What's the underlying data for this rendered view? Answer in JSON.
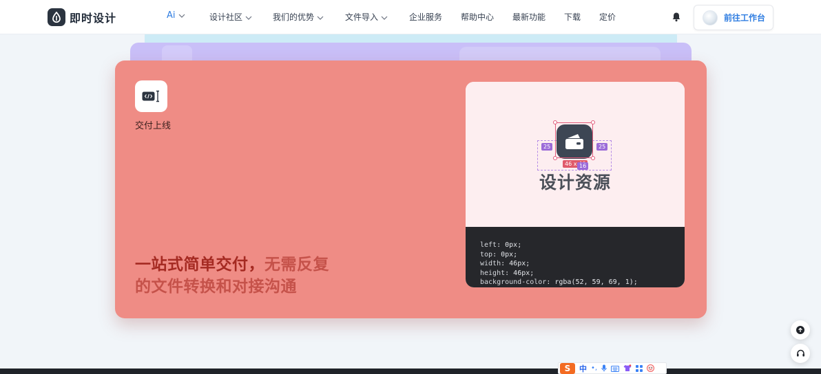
{
  "brand": {
    "name": "即时设计"
  },
  "nav": {
    "ai_label": "Ai",
    "items": [
      {
        "label": "设计社区",
        "has_dropdown": true
      },
      {
        "label": "我们的优势",
        "has_dropdown": true
      },
      {
        "label": "文件导入",
        "has_dropdown": true
      },
      {
        "label": "企业服务",
        "has_dropdown": false
      },
      {
        "label": "帮助中心",
        "has_dropdown": false
      },
      {
        "label": "最新功能",
        "has_dropdown": false
      },
      {
        "label": "下载",
        "has_dropdown": false
      },
      {
        "label": "定价",
        "has_dropdown": false
      }
    ],
    "workbench_label": "前往工作台"
  },
  "feature": {
    "label": "交付上线",
    "headline_strong": "一站式简单交付，",
    "headline_soft_1": "无需反复",
    "headline_soft_2": "的文件转换和对接沟通",
    "preview": {
      "title": "设计资源",
      "measure_left": "25",
      "measure_right": "25",
      "measure_size": "46 x 46",
      "measure_bottom": "16",
      "code": {
        "line1_key": "left",
        "line1_val": "0px;",
        "line2_key": "top",
        "line2_val": "0px;",
        "line3_key": "width",
        "line3_val": "46px;",
        "line4_key": "height",
        "line4_val": "46px;",
        "line5_key": "background-color",
        "line5_val": "rgba(52, 59, 69, 1);"
      }
    }
  },
  "ime": {
    "logo": "S",
    "mode": "中",
    "punct": "•,"
  },
  "colors": {
    "accent": "#2f7de1",
    "card": "#ef8c85",
    "headline_strong": "#a52a22",
    "headline_soft": "#c5524a",
    "stack_back": "#cdebf6",
    "stack_mid": "#c9bff8"
  }
}
